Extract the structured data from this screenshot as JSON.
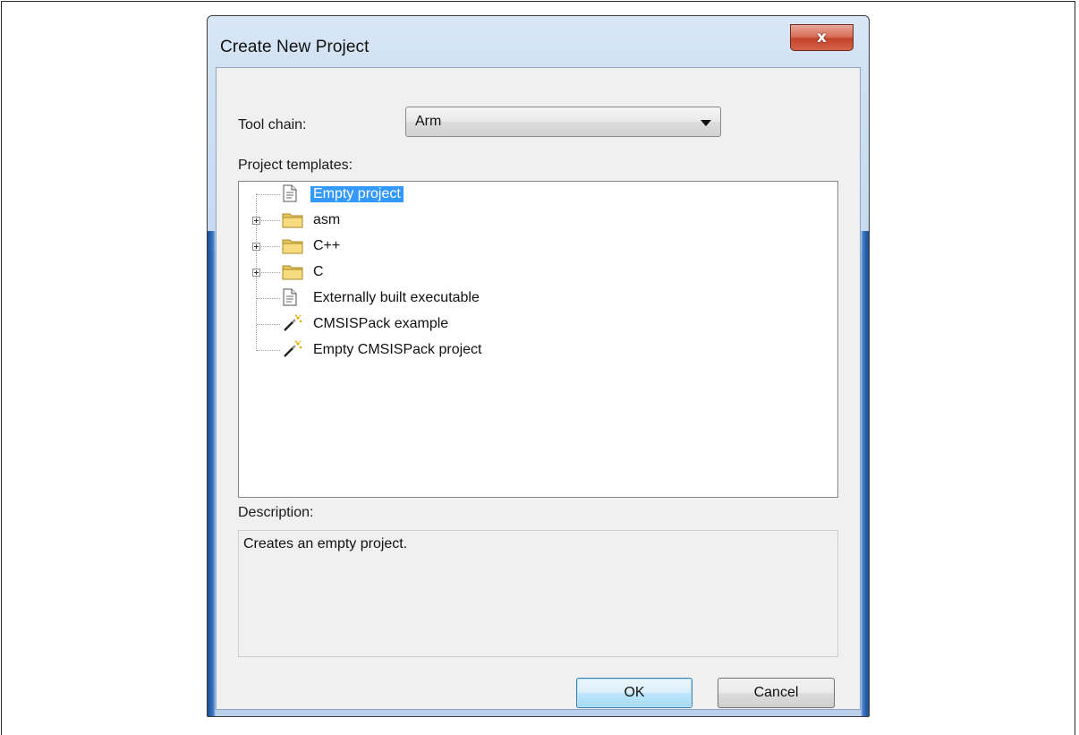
{
  "window": {
    "title": "Create New Project",
    "close_glyph": "x"
  },
  "form": {
    "toolchain_label": "Tool chain:",
    "toolchain_value": "Arm",
    "templates_label": "Project templates:",
    "description_label": "Description:",
    "description_text": "Creates an empty project."
  },
  "tree": {
    "items": [
      {
        "label": "Empty project",
        "icon": "document-icon",
        "expandable": false,
        "selected": true
      },
      {
        "label": "asm",
        "icon": "folder-icon",
        "expandable": true,
        "selected": false
      },
      {
        "label": "C++",
        "icon": "folder-icon",
        "expandable": true,
        "selected": false
      },
      {
        "label": "C",
        "icon": "folder-icon",
        "expandable": true,
        "selected": false
      },
      {
        "label": "Externally built executable",
        "icon": "document-icon",
        "expandable": false,
        "selected": false
      },
      {
        "label": "CMSISPack example",
        "icon": "magic-wand-icon",
        "expandable": false,
        "selected": false
      },
      {
        "label": "Empty CMSISPack project",
        "icon": "magic-wand-icon",
        "expandable": false,
        "selected": false
      }
    ]
  },
  "buttons": {
    "ok_label": "OK",
    "cancel_label": "Cancel"
  },
  "colors": {
    "selection": "#3399ff",
    "close_button": "#c2432a",
    "dialog_background": "#f0f0f0"
  }
}
